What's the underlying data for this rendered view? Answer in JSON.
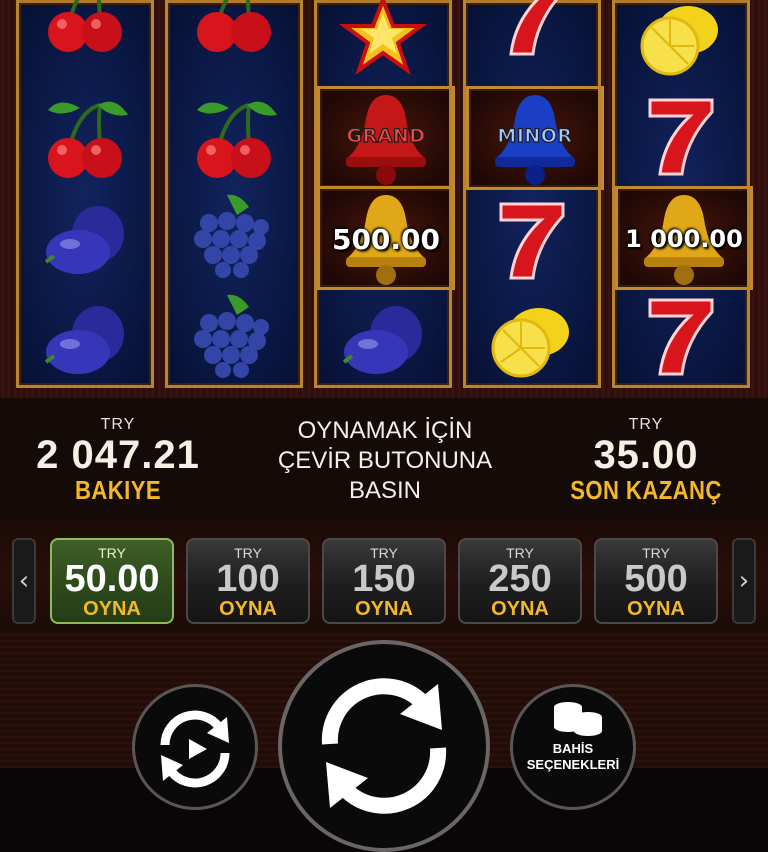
{
  "reels": [
    {
      "symbols": [
        "cherry",
        "cherry",
        "plum",
        "plum"
      ]
    },
    {
      "symbols": [
        "cherry",
        "cherry",
        "grapes",
        "grapes"
      ]
    },
    {
      "symbols": [
        "star",
        "bell-grand",
        "bell-value",
        "plum"
      ]
    },
    {
      "symbols": [
        "seven",
        "bell-minor",
        "seven",
        "lemon"
      ]
    },
    {
      "symbols": [
        "lemon",
        "seven",
        "bell-value",
        "seven"
      ]
    }
  ],
  "jackpots": {
    "grand_label": "GRAND",
    "minor_label": "MINOR",
    "bell_value_reel3": "500.00",
    "bell_value_reel5": "1 000.00"
  },
  "balance": {
    "currency": "TRY",
    "value": "2 047.21",
    "label": "BAKIYE"
  },
  "prompt": {
    "line1": "OYNAMAK İÇİN",
    "line2": "ÇEVİR BUTONUNA",
    "line3": "BASIN"
  },
  "last_win": {
    "currency": "TRY",
    "value": "35.00",
    "label": "SON KAZANÇ"
  },
  "bets": [
    {
      "currency": "TRY",
      "value": "50.00",
      "action": "OYNA",
      "active": true
    },
    {
      "currency": "TRY",
      "value": "100",
      "action": "OYNA",
      "active": false
    },
    {
      "currency": "TRY",
      "value": "150",
      "action": "OYNA",
      "active": false
    },
    {
      "currency": "TRY",
      "value": "250",
      "action": "OYNA",
      "active": false
    },
    {
      "currency": "TRY",
      "value": "500",
      "action": "OYNA",
      "active": false
    }
  ],
  "nav": {
    "prev": "‹",
    "next": "›"
  },
  "bet_options": {
    "line1": "BAHİS",
    "line2": "SEÇENEKLERİ"
  },
  "colors": {
    "accent": "#f2b82a",
    "active_bet": "#2e4a1c",
    "reel_bg": "#0b1a4a",
    "frame": "#b88430"
  }
}
